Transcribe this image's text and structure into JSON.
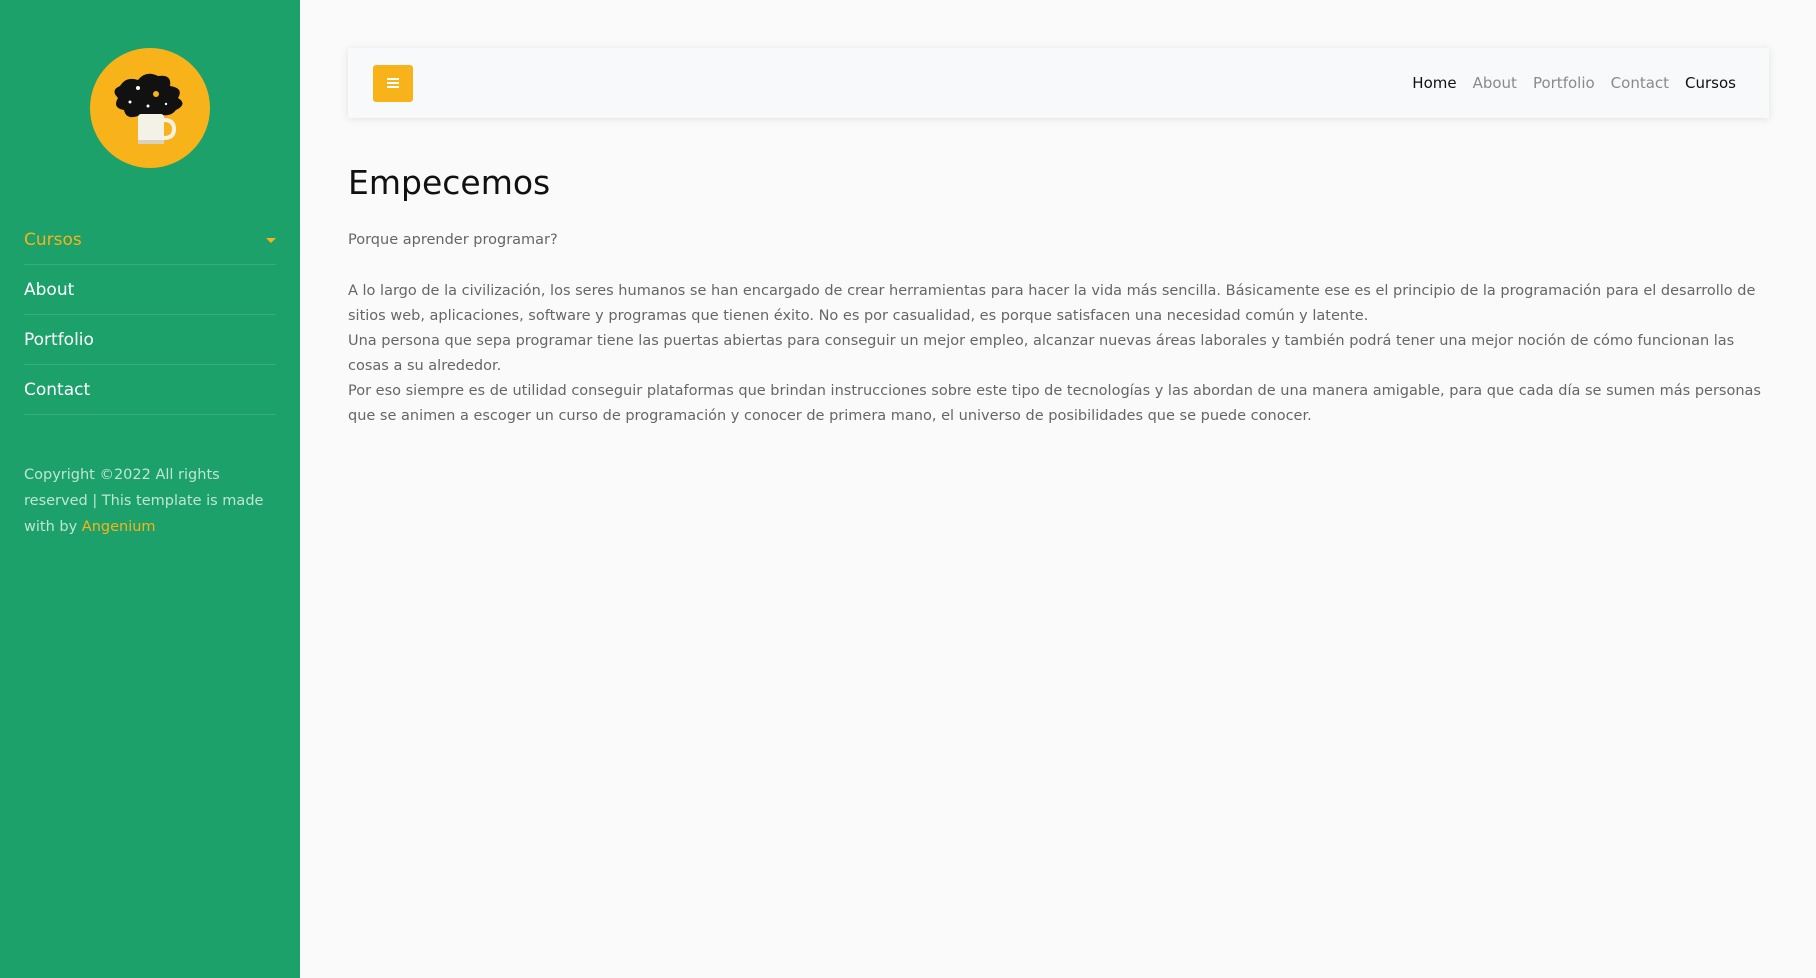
{
  "sidebar": {
    "logo_icon": "coffee-mug-galaxy-logo",
    "nav_items": [
      {
        "label": "Cursos"
      },
      {
        "label": "About"
      },
      {
        "label": "Portfolio"
      },
      {
        "label": "Contact"
      }
    ],
    "footer": {
      "text": "Copyright ©2022 All rights reserved | This template is made with by",
      "link": "Angenium"
    }
  },
  "topbar": {
    "menu_icon": "hamburger-icon",
    "links": [
      "Home",
      "About",
      "Portfolio",
      "Contact",
      "Cursos"
    ]
  },
  "main": {
    "title": "Empecemos",
    "subtitle": "Porque aprender programar?",
    "paragraph_1": "A lo largo de la civilización, los seres humanos se han encargado de crear herramientas para hacer la vida más sencilla. Básicamente ese es el principio de la programación para el desarrollo de sitios web, aplicaciones, software y programas que tienen éxito. No es por casualidad, es porque satisfacen una necesidad común y latente.",
    "paragraph_2": "Una persona que sepa programar tiene las puertas abiertas para conseguir un mejor empleo, alcanzar nuevas áreas laborales y también podrá tener una mejor noción de cómo funcionan las cosas a su alrededor.",
    "paragraph_3": "Por eso siempre es de utilidad conseguir plataformas que brindan instrucciones sobre este tipo de tecnologías y las abordan de una manera amigable, para que cada día se sumen más personas que se animen a escoger un curso de programación y conocer de primera mano, el universo de posibilidades que se puede conocer."
  },
  "colors": {
    "sidebar_bg": "#1ca16a",
    "accent": "#f8b31b",
    "page_bg": "#fafafa"
  }
}
